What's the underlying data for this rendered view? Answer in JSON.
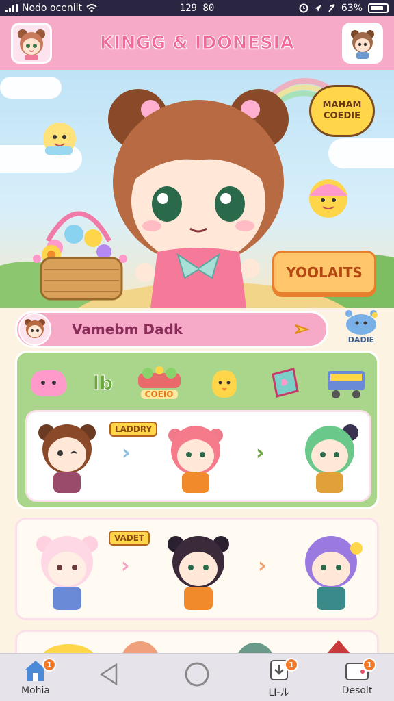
{
  "status_bar": {
    "carrier": "Nodo ocenilt",
    "time": "129 80",
    "battery": "63%",
    "icons": [
      "signal-icon",
      "wifi-icon",
      "alarm-icon",
      "location-icon",
      "battery-icon"
    ]
  },
  "header": {
    "title": "KINGG & IDONESIA",
    "left_avatar": "avatar-icon",
    "right_avatar": "avatar-icon"
  },
  "hero": {
    "speech_bubble": "MAHAM\nCOEDIE",
    "action_button": "YOOLAITS"
  },
  "search": {
    "text": "Vamebm Dadk",
    "side_label": "DADIE"
  },
  "categories": {
    "items": [
      {
        "icon": "blob-icon"
      },
      {
        "icon": "letters-icon",
        "label": "lb"
      },
      {
        "icon": "shop-icon",
        "label": "COEIO"
      },
      {
        "icon": "chick-icon"
      },
      {
        "icon": "card-icon"
      },
      {
        "icon": "truck-icon"
      }
    ]
  },
  "cards": [
    {
      "tag": "LADDRY"
    },
    {
      "tag": "VADET"
    }
  ],
  "bottom_nav": {
    "items": [
      {
        "label": "Mohia",
        "icon": "home-icon",
        "badge": "1"
      },
      {
        "label": "",
        "icon": "back-icon"
      },
      {
        "label": "",
        "icon": "circle-icon"
      },
      {
        "label": "LI-ル",
        "icon": "download-icon",
        "badge": "1"
      },
      {
        "label": "Desolt",
        "icon": "card-icon",
        "badge": "1"
      }
    ]
  },
  "colors": {
    "header_pink": "#f7a9c8",
    "title_pink": "#f06a9a",
    "panel_green": "#a9d68a",
    "accent_orange": "#ffc66b",
    "status_bar": "#2a2540"
  }
}
